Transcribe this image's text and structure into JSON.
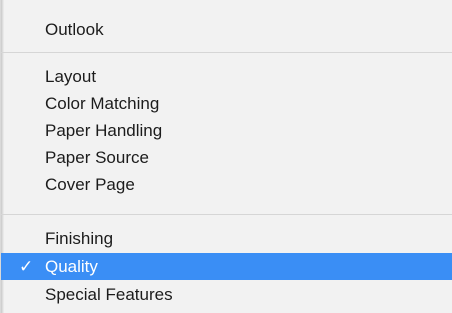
{
  "menu": {
    "groups": [
      {
        "items": [
          {
            "label": "Outlook"
          }
        ]
      },
      {
        "items": [
          {
            "label": "Layout"
          },
          {
            "label": "Color Matching"
          },
          {
            "label": "Paper Handling"
          },
          {
            "label": "Paper Source"
          },
          {
            "label": "Cover Page"
          }
        ]
      },
      {
        "items": [
          {
            "label": "Finishing"
          },
          {
            "label": "Quality",
            "selected": true,
            "checkmark": "✓"
          },
          {
            "label": "Special Features"
          }
        ]
      }
    ]
  },
  "colors": {
    "menu_background": "#f2f2f2",
    "selection_background": "#3a8ef5",
    "selected_text": "#ffffff",
    "text": "#1c1c1c",
    "separator": "#d6d6d6"
  }
}
